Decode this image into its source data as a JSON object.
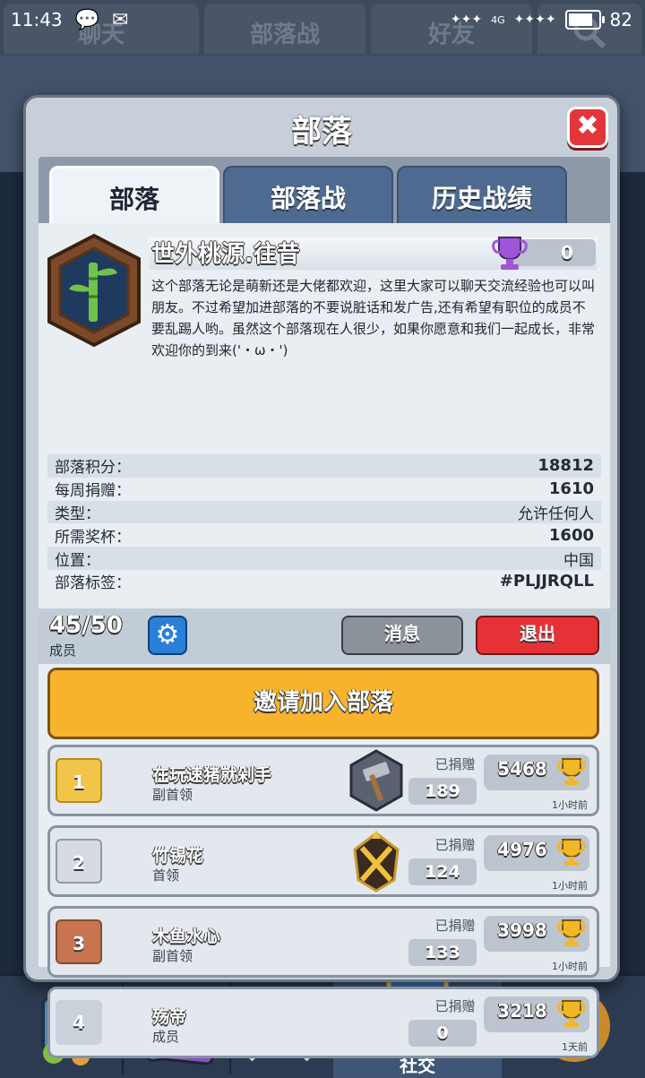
{
  "status_bar": {
    "time": "11:43",
    "network": "4G",
    "battery": "82"
  },
  "background_tabs": [
    "聊天",
    "部落战",
    "好友"
  ],
  "modal": {
    "title": "部落",
    "close_label": "✖"
  },
  "tabs": [
    "部落",
    "部落战",
    "历史战绩"
  ],
  "clan": {
    "name": "世外桃源.往昔",
    "trophies": "0",
    "description": "这个部落无论是萌新还是大佬都欢迎，这里大家可以聊天交流经验也可以叫朋友。不过希望加进部落的不要说脏话和发广告,还有希望有职位的成员不要乱踢人哟。虽然这个部落现在人很少，如果你愿意和我们一起成长，非常欢迎你的到来('・ω・')"
  },
  "info": [
    {
      "label": "部落积分：",
      "value": "18812"
    },
    {
      "label": "每周捐赠：",
      "value": "1610"
    },
    {
      "label": "类型：",
      "value": "允许任何人"
    },
    {
      "label": "所需奖杯：",
      "value": "1600"
    },
    {
      "label": "位置：",
      "value": "中国"
    },
    {
      "label": "部落标签：",
      "value": "#PLJJRQLL"
    }
  ],
  "members_summary": {
    "count": "45/50",
    "label": "成员"
  },
  "buttons": {
    "message": "消息",
    "exit": "退出",
    "invite": "邀请加入部落"
  },
  "donated_label": "已捐赠",
  "members": [
    {
      "rank": "1",
      "name": "在玩速猪就剁手",
      "role": "副首领",
      "donated": "189",
      "trophies": "5468",
      "last_seen": "1小时前"
    },
    {
      "rank": "2",
      "name": "竹锡花",
      "role": "首领",
      "donated": "124",
      "trophies": "4976",
      "last_seen": "1小时前"
    },
    {
      "rank": "3",
      "name": "木鱼水心",
      "role": "副首领",
      "donated": "133",
      "trophies": "3998",
      "last_seen": "1小时前"
    },
    {
      "rank": "4",
      "name": "殇帝",
      "role": "成员",
      "donated": "0",
      "trophies": "3218",
      "last_seen": "1天前"
    }
  ],
  "bottom_nav": {
    "active_label": "社交"
  },
  "colors": {
    "invite": "#f7b32b",
    "exit": "#e63236",
    "message": "#8c9299",
    "tab_inactive": "#4e6a91"
  }
}
